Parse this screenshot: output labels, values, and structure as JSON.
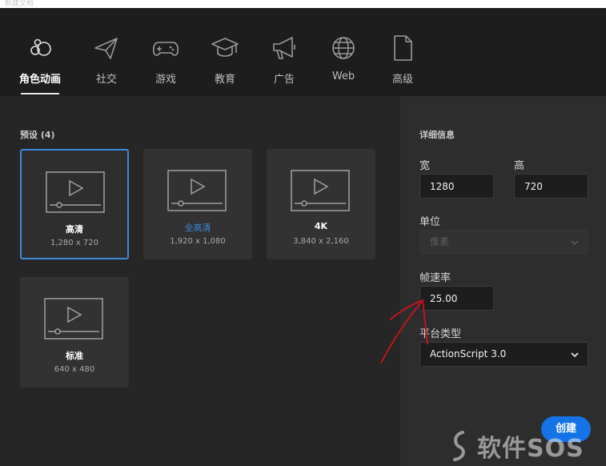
{
  "window": {
    "title": "新建文档"
  },
  "categories": [
    {
      "label": "角色动画",
      "icon": "character-animation-icon",
      "active": true
    },
    {
      "label": "社交",
      "icon": "paper-plane-icon",
      "active": false
    },
    {
      "label": "游戏",
      "icon": "gamepad-icon",
      "active": false
    },
    {
      "label": "教育",
      "icon": "graduation-cap-icon",
      "active": false
    },
    {
      "label": "广告",
      "icon": "megaphone-icon",
      "active": false
    },
    {
      "label": "Web",
      "icon": "globe-icon",
      "active": false
    },
    {
      "label": "高级",
      "icon": "document-icon",
      "active": false
    }
  ],
  "presets": {
    "title": "预设 (4)",
    "items": [
      {
        "name": "高清",
        "dims": "1,280 x 720",
        "selected": true,
        "name_color": "#ffffff"
      },
      {
        "name": "全高清",
        "dims": "1,920 x 1,080",
        "selected": false,
        "name_color": "#3d88d8"
      },
      {
        "name": "4K",
        "dims": "3,840 x 2,160",
        "selected": false,
        "name_color": "#ffffff"
      },
      {
        "name": "标准",
        "dims": "640 x 480",
        "selected": false,
        "name_color": "#ffffff"
      }
    ]
  },
  "details": {
    "title": "详细信息",
    "width_label": "宽",
    "width_value": "1280",
    "height_label": "高",
    "height_value": "720",
    "unit_label": "单位",
    "unit_value": "像素",
    "unit_disabled": true,
    "fps_label": "帧速率",
    "fps_value": "25.00",
    "platform_label": "平台类型",
    "platform_value": "ActionScript 3.0"
  },
  "actions": {
    "create_label": "创建"
  },
  "watermark": {
    "text": "软件SOS"
  },
  "colors": {
    "accent": "#1473e6",
    "selection": "#3d88d8",
    "background": "#262626",
    "annotation": "#c0141c"
  }
}
